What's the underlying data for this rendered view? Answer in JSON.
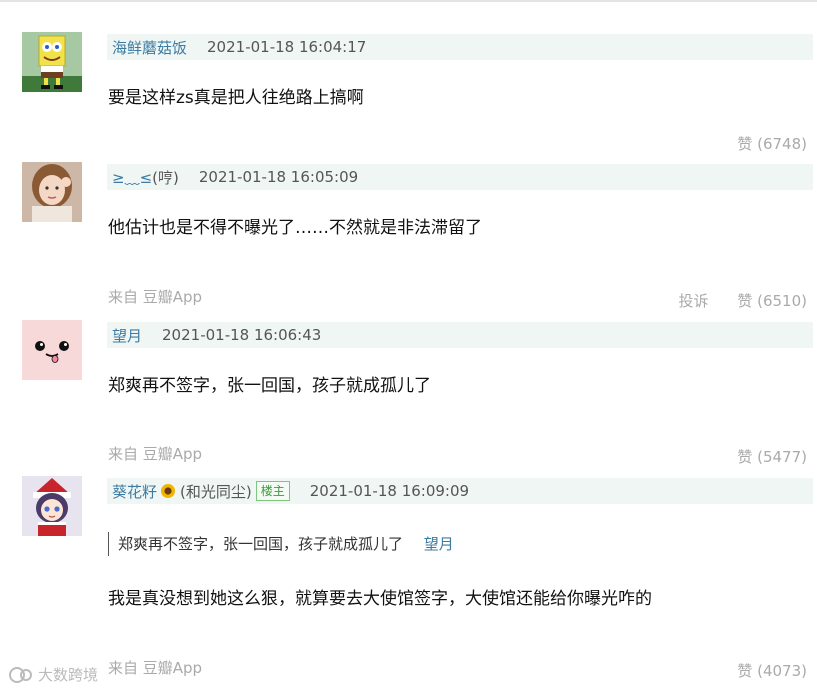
{
  "comments": [
    {
      "author": "海鲜蘑菇饭",
      "author_extra": "",
      "time": "2021-01-18 16:04:17",
      "text": "要是这样zs真是把人往绝路上搞啊",
      "source": "",
      "report": "",
      "likes": "赞 (6748)",
      "avatar": "spongebob-avatar"
    },
    {
      "author": "≥﹏≤",
      "author_extra": "(哼)",
      "time": "2021-01-18 16:05:09",
      "text": "他估计也是不得不曝光了……不然就是非法滞留了",
      "source": "来自 豆瓣App",
      "report": "投诉",
      "likes": "赞 (6510)",
      "avatar": "woman-photo-avatar"
    },
    {
      "author": "望月",
      "author_extra": "",
      "time": "2021-01-18 16:06:43",
      "text": "郑爽再不签字，张一回国，孩子就成孤儿了",
      "source": "来自 豆瓣App",
      "report": "",
      "likes": "赞 (5477)",
      "avatar": "pink-face-avatar"
    },
    {
      "author": "葵花籽",
      "author_extra": "(和光同尘)",
      "badge": "楼主",
      "time": "2021-01-18 16:09:09",
      "quote": {
        "text": "郑爽再不签字，张一回国，孩子就成孤儿了",
        "author": "望月"
      },
      "text": "我是真没想到她这么狠，就算要去大使馆签字，大使馆还能给你曝光咋的",
      "source": "来自 豆瓣App",
      "report": "",
      "likes": "赞 (4073)",
      "avatar": "anime-girl-avatar"
    }
  ],
  "watermark": "大数跨境",
  "colors": {
    "author_link": "#3c7ba3",
    "meta_bar_bg": "#f0f6f3",
    "muted": "#aaaaaa",
    "badge_green": "#3a9a3a"
  }
}
